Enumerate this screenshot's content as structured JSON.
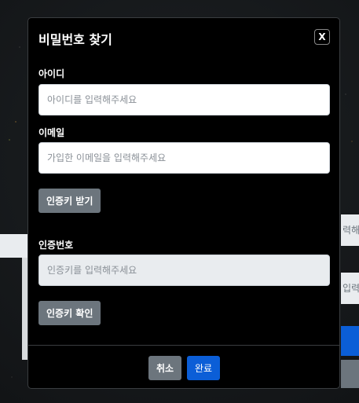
{
  "dialog": {
    "title": "비밀번호 찾기",
    "close_label": "X"
  },
  "id_field": {
    "label": "아이디",
    "placeholder": "아이디를 입력해주세요"
  },
  "email_field": {
    "label": "이메일",
    "placeholder": "가입한 이메일을 입력해주세요"
  },
  "get_code_button": "인증키 받기",
  "code_field": {
    "label": "인증번호",
    "placeholder": "인증키를 입력해주세요"
  },
  "verify_code_button": "인증키 확인",
  "footer": {
    "cancel_label": "취소",
    "done_label": "완료"
  },
  "background": {
    "input_fragment_1": "력해",
    "input_fragment_2": "입력"
  },
  "colors": {
    "primary": "#0b5ed7",
    "secondary": "#6c757d",
    "modal_bg": "#000000"
  }
}
